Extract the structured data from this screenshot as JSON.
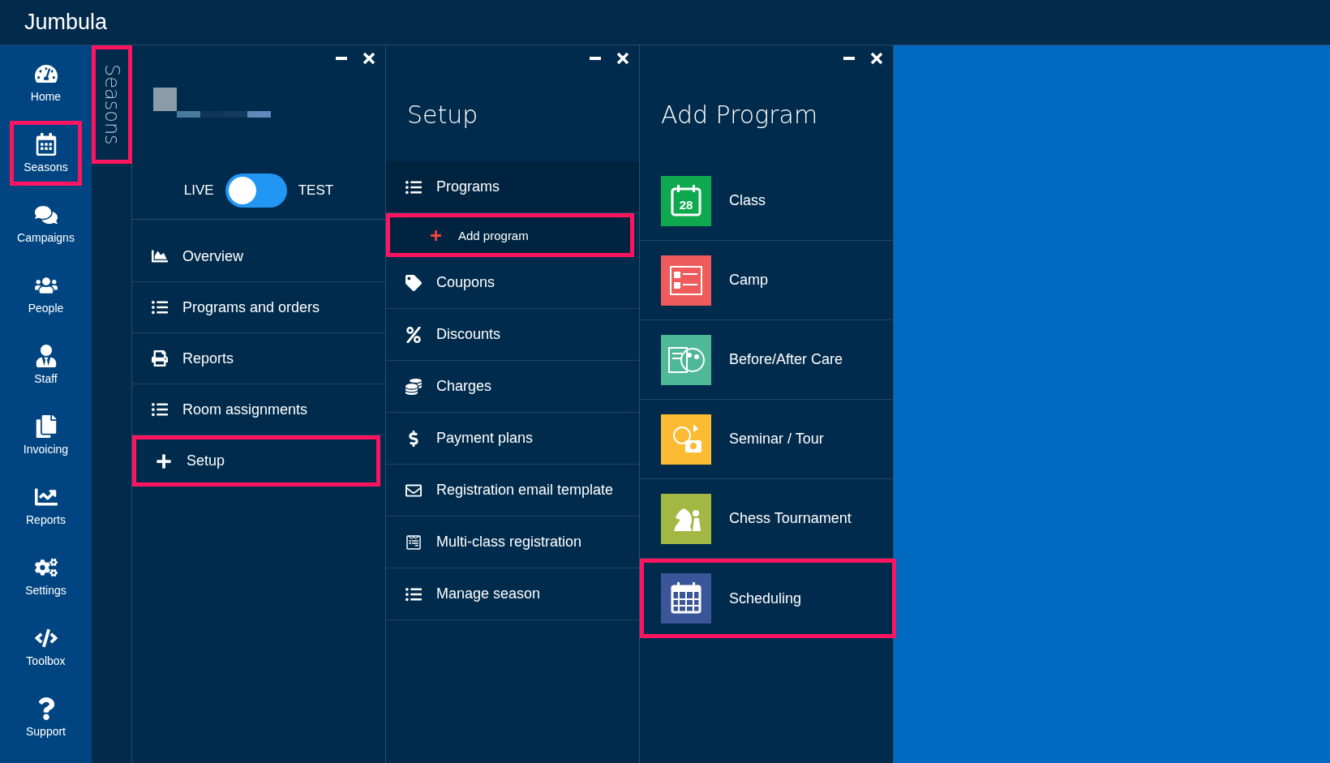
{
  "app": {
    "title": "Jumbula"
  },
  "nav": [
    {
      "label": "Home",
      "selected": false
    },
    {
      "label": "Seasons",
      "selected": true
    },
    {
      "label": "Campaigns",
      "selected": false
    },
    {
      "label": "People",
      "selected": false
    },
    {
      "label": "Staff",
      "selected": false
    },
    {
      "label": "Invoicing",
      "selected": false
    },
    {
      "label": "Reports",
      "selected": false
    },
    {
      "label": "Settings",
      "selected": false
    },
    {
      "label": "Toolbox",
      "selected": false
    },
    {
      "label": "Support",
      "selected": false
    }
  ],
  "side_tab": {
    "label": "Seasons",
    "highlighted": true
  },
  "season_panel": {
    "mode_toggle": {
      "left_label": "LIVE",
      "right_label": "TEST",
      "on": false
    },
    "items": [
      {
        "label": "Overview",
        "highlighted": false
      },
      {
        "label": "Programs and orders",
        "highlighted": false
      },
      {
        "label": "Reports",
        "highlighted": false
      },
      {
        "label": "Room assignments",
        "highlighted": false
      },
      {
        "label": "Setup",
        "highlighted": true
      }
    ]
  },
  "setup_panel": {
    "title": "Setup",
    "items": [
      {
        "label": "Programs",
        "kind": "group",
        "highlighted": false
      },
      {
        "label": "Add program",
        "kind": "sub",
        "highlighted": true
      },
      {
        "label": "Coupons",
        "kind": "item",
        "highlighted": false
      },
      {
        "label": "Discounts",
        "kind": "item",
        "highlighted": false
      },
      {
        "label": "Charges",
        "kind": "item",
        "highlighted": false
      },
      {
        "label": "Payment plans",
        "kind": "item",
        "highlighted": false
      },
      {
        "label": "Registration email template",
        "kind": "item",
        "highlighted": false
      },
      {
        "label": "Multi-class registration",
        "kind": "item",
        "highlighted": false
      },
      {
        "label": "Manage season",
        "kind": "item",
        "highlighted": false
      }
    ]
  },
  "add_program_panel": {
    "title": "Add Program",
    "types": [
      {
        "label": "Class",
        "tile_text": "28",
        "color": "#0ea84f",
        "highlighted": false
      },
      {
        "label": "Camp",
        "color": "#ef5a5a",
        "highlighted": false
      },
      {
        "label": "Before/After Care",
        "color": "#4fb896",
        "highlighted": false
      },
      {
        "label": "Seminar / Tour",
        "color": "#fbbb33",
        "highlighted": false
      },
      {
        "label": "Chess Tournament",
        "color": "#a2b843",
        "highlighted": false
      },
      {
        "label": "Scheduling",
        "color": "#3a5699",
        "highlighted": true
      }
    ]
  }
}
